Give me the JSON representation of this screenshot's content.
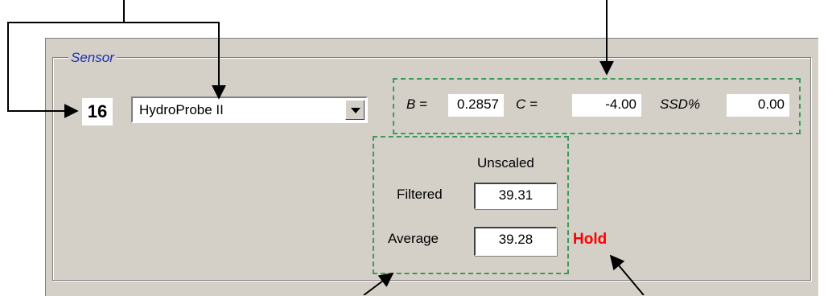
{
  "group": {
    "title": "Sensor"
  },
  "sensor": {
    "number": "16",
    "model": "HydroProbe II"
  },
  "coefficients": {
    "b_label": "B =",
    "b_value": "0.2857",
    "c_label": "C =",
    "c_value": "-4.00",
    "ssd_label": "SSD%",
    "ssd_value": "0.00"
  },
  "readings": {
    "column_header": "Unscaled",
    "filtered_label": "Filtered",
    "filtered_value": "39.31",
    "average_label": "Average",
    "average_value": "39.28"
  },
  "status": {
    "hold": "Hold"
  },
  "colors": {
    "panel": "#d4d0c8",
    "group_title": "#1a2fb0",
    "dash": "#3c9a5a",
    "hold": "#ff0000"
  },
  "icons": [
    "dropdown-arrow-icon",
    "callout-arrow"
  ]
}
